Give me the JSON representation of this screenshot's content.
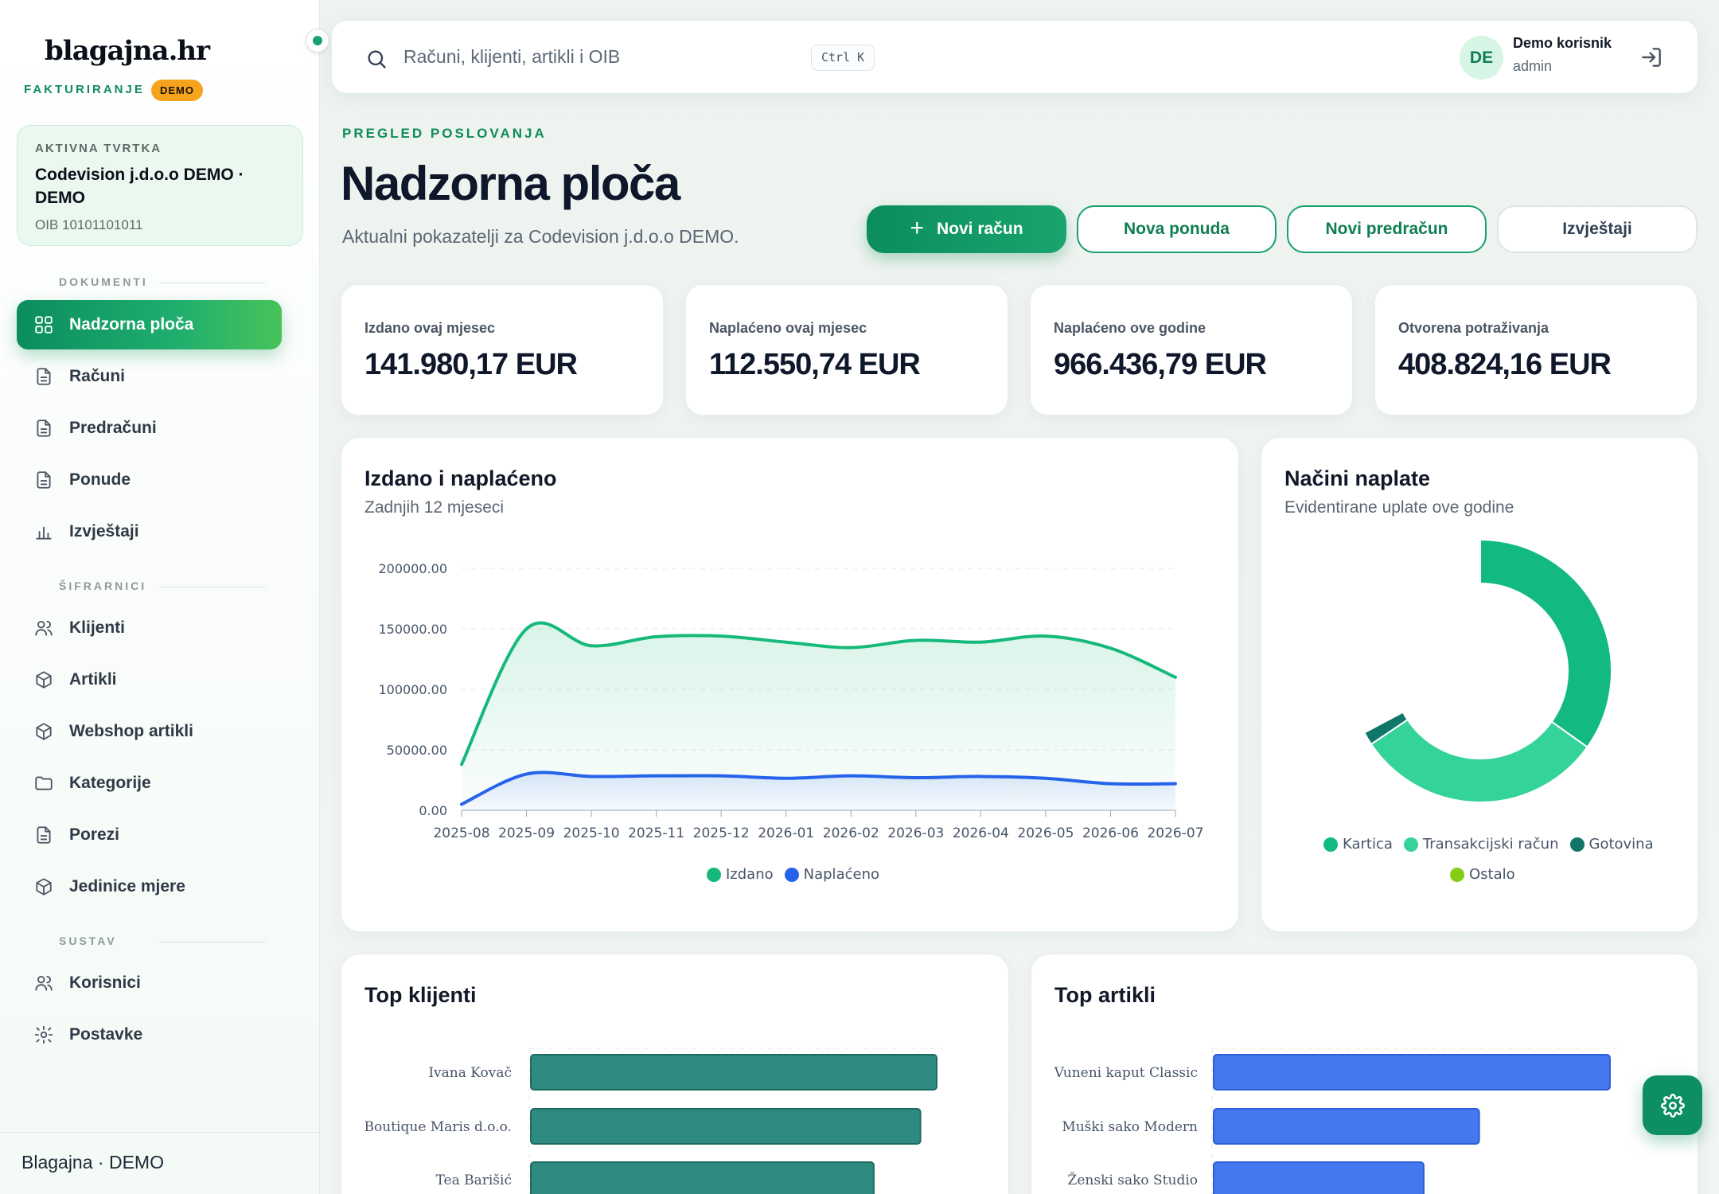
{
  "sidebar": {
    "brand": "blagajna.hr",
    "brand_sub": "FAKTURIRANJE",
    "demo_badge": "DEMO",
    "company": {
      "label": "AKTIVNA TVRTKA",
      "name": "Codevision j.d.o.o DEMO · DEMO",
      "oib": "OIB 10101101011"
    },
    "sections": {
      "documents": "DOKUMENTI",
      "codebooks": "ŠIFRARNICI",
      "system": "SUSTAV"
    },
    "items": [
      {
        "label": "Nadzorna ploča",
        "icon": "dashboard-icon",
        "active": true
      },
      {
        "label": "Računi",
        "icon": "document-icon"
      },
      {
        "label": "Predračuni",
        "icon": "document-icon"
      },
      {
        "label": "Ponude",
        "icon": "document-icon"
      },
      {
        "label": "Izvještaji",
        "icon": "bar-chart-icon"
      },
      {
        "label": "Klijenti",
        "icon": "users-icon"
      },
      {
        "label": "Artikli",
        "icon": "box-icon"
      },
      {
        "label": "Webshop artikli",
        "icon": "box-icon"
      },
      {
        "label": "Kategorije",
        "icon": "folder-icon"
      },
      {
        "label": "Porezi",
        "icon": "document-icon"
      },
      {
        "label": "Jedinice mjere",
        "icon": "box-icon"
      },
      {
        "label": "Korisnici",
        "icon": "users-icon"
      },
      {
        "label": "Postavke",
        "icon": "gear-icon"
      }
    ],
    "footer": "Blagajna · DEMO"
  },
  "topbar": {
    "search_placeholder": "Računi, klijenti, artikli i OIB",
    "shortcut": "Ctrl K",
    "avatar_initials": "DE",
    "user_name": "Demo korisnik",
    "user_role": "admin"
  },
  "header": {
    "eyebrow": "PREGLED POSLOVANJA",
    "title": "Nadzorna ploča",
    "subtitle": "Aktualni pokazatelji za Codevision j.d.o.o DEMO.",
    "buttons": {
      "new_invoice": "Novi račun",
      "new_offer": "Nova ponuda",
      "new_proforma": "Novi predračun",
      "reports": "Izvještaji"
    }
  },
  "stats": [
    {
      "label": "Izdano ovaj mjesec",
      "value": "141.980,17 EUR"
    },
    {
      "label": "Naplaćeno ovaj mjesec",
      "value": "112.550,74 EUR"
    },
    {
      "label": "Naplaćeno ove godine",
      "value": "966.436,79 EUR"
    },
    {
      "label": "Otvorena potraživanja",
      "value": "408.824,16 EUR"
    }
  ],
  "colors": {
    "accent": "#0f8a5c",
    "issued": "#16b97a",
    "paid": "#2563eb",
    "card": "#12b981",
    "transfer": "#34d399",
    "cash": "#11766a",
    "other": "#84cc16",
    "clients_bar": "#2f8a80",
    "articles_bar": "#4478ef"
  },
  "charts": {
    "issued_paid_title": "Izdano i naplaćeno",
    "issued_paid_sub": "Zadnjih 12 mjeseci",
    "methods_title": "Načini naplate",
    "methods_sub": "Evidentirane uplate ove godine",
    "top_clients_title": "Top klijenti",
    "top_articles_title": "Top artikli"
  },
  "chart_data": [
    {
      "type": "area",
      "title": "Izdano i naplaćeno",
      "subtitle": "Zadnjih 12 mjeseci",
      "x": [
        "2025-08",
        "2025-09",
        "2025-10",
        "2025-11",
        "2025-12",
        "2026-01",
        "2026-02",
        "2026-03",
        "2026-04",
        "2026-05",
        "2026-06",
        "2026-07"
      ],
      "y_ticks": [
        "0.00",
        "50000.00",
        "100000.00",
        "150000.00",
        "200000.00"
      ],
      "ylim": [
        0,
        200000
      ],
      "grid": true,
      "legend": "bottom",
      "series": [
        {
          "name": "Izdano",
          "values": [
            38000,
            150000,
            136000,
            143500,
            144000,
            139000,
            134500,
            140500,
            139000,
            144000,
            134000,
            110000
          ]
        },
        {
          "name": "Naplaćeno",
          "values": [
            5000,
            30000,
            28000,
            28500,
            28500,
            26500,
            28500,
            27000,
            28000,
            26500,
            22000,
            22000
          ]
        }
      ]
    },
    {
      "type": "pie",
      "title": "Načini naplate",
      "subtitle": "Evidentirane uplate ove godine",
      "legend": "bottom",
      "labels": [
        "Kartica",
        "Transakcijski račun",
        "Gotovina",
        "Ostalo"
      ],
      "values": [
        43,
        38,
        2,
        0
      ]
    },
    {
      "type": "bar",
      "title": "Top klijenti",
      "orientation": "horizontal",
      "categories": [
        "Ivana Kovač",
        "Boutique Maris d.o.o.",
        "Tea Barišić"
      ],
      "values": [
        100,
        96,
        84.5
      ]
    },
    {
      "type": "bar",
      "title": "Top artikli",
      "orientation": "horizontal",
      "categories": [
        "Vuneni kaput Classic",
        "Muški sako Modern",
        "Ženski sako Studio"
      ],
      "values": [
        100,
        67,
        53
      ]
    }
  ]
}
